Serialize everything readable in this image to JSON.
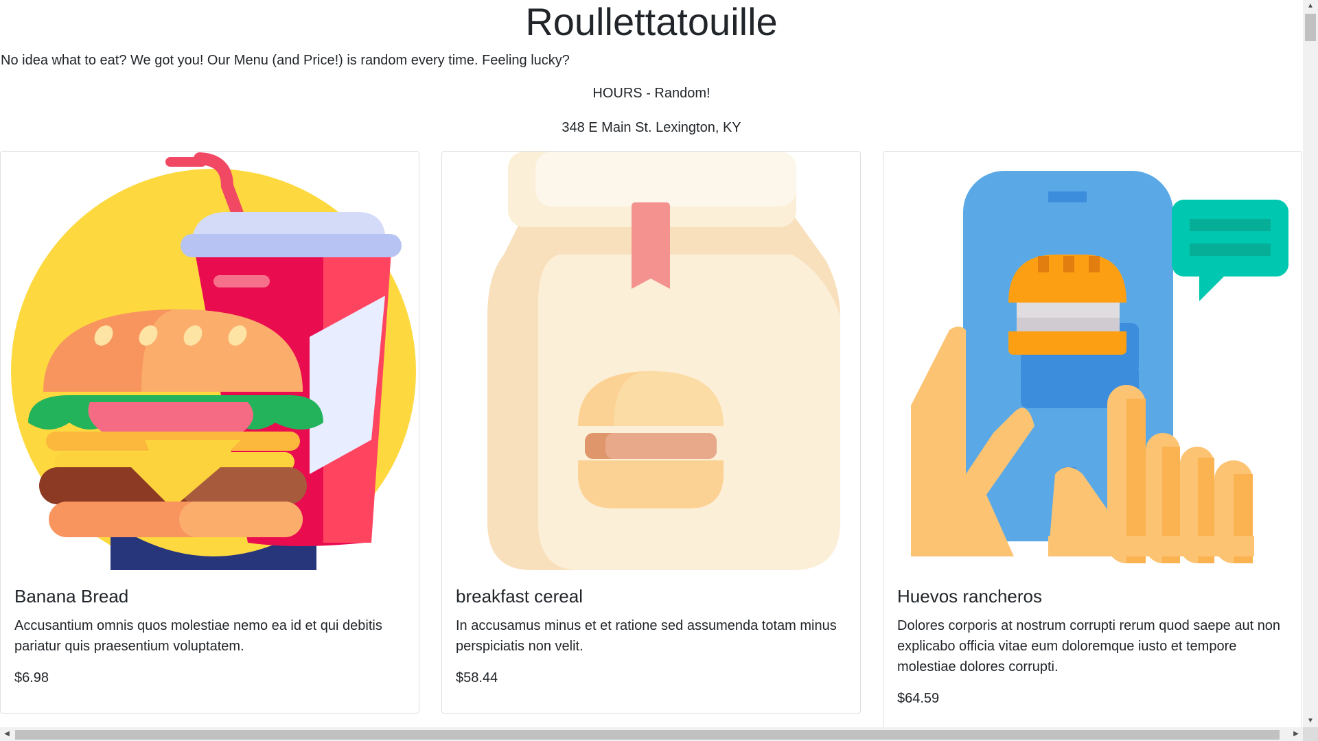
{
  "header": {
    "title": "Roullettatouille",
    "tagline": "No idea what to eat? We got you! Our Menu (and Price!) is random every time. Feeling lucky?",
    "hours": "HOURS - Random!",
    "address": "348 E Main St. Lexington, KY"
  },
  "menu": {
    "items": [
      {
        "name": "Banana Bread",
        "description": "Accusantium omnis quos molestiae nemo ea id et qui debitis pariatur quis praesentium voluptatem.",
        "price": "$6.98",
        "image_icon": "burger-and-drink-icon"
      },
      {
        "name": "breakfast cereal",
        "description": "In accusamus minus et et ratione sed assumenda totam minus perspiciatis non velit.",
        "price": "$58.44",
        "image_icon": "takeout-bag-burger-icon"
      },
      {
        "name": "Huevos rancheros",
        "description": "Dolores corporis at nostrum corrupti rerum quod saepe aut non explicabo officia vitae eum doloremque iusto et tempore molestiae dolores corrupti.",
        "price": "$64.59",
        "image_icon": "phone-order-burger-icon"
      }
    ]
  },
  "colors": {
    "text": "#212529",
    "card_border": "#dfdfdf",
    "scrollbar_track": "#f1f1f1",
    "scrollbar_thumb": "#c1c1c1"
  }
}
